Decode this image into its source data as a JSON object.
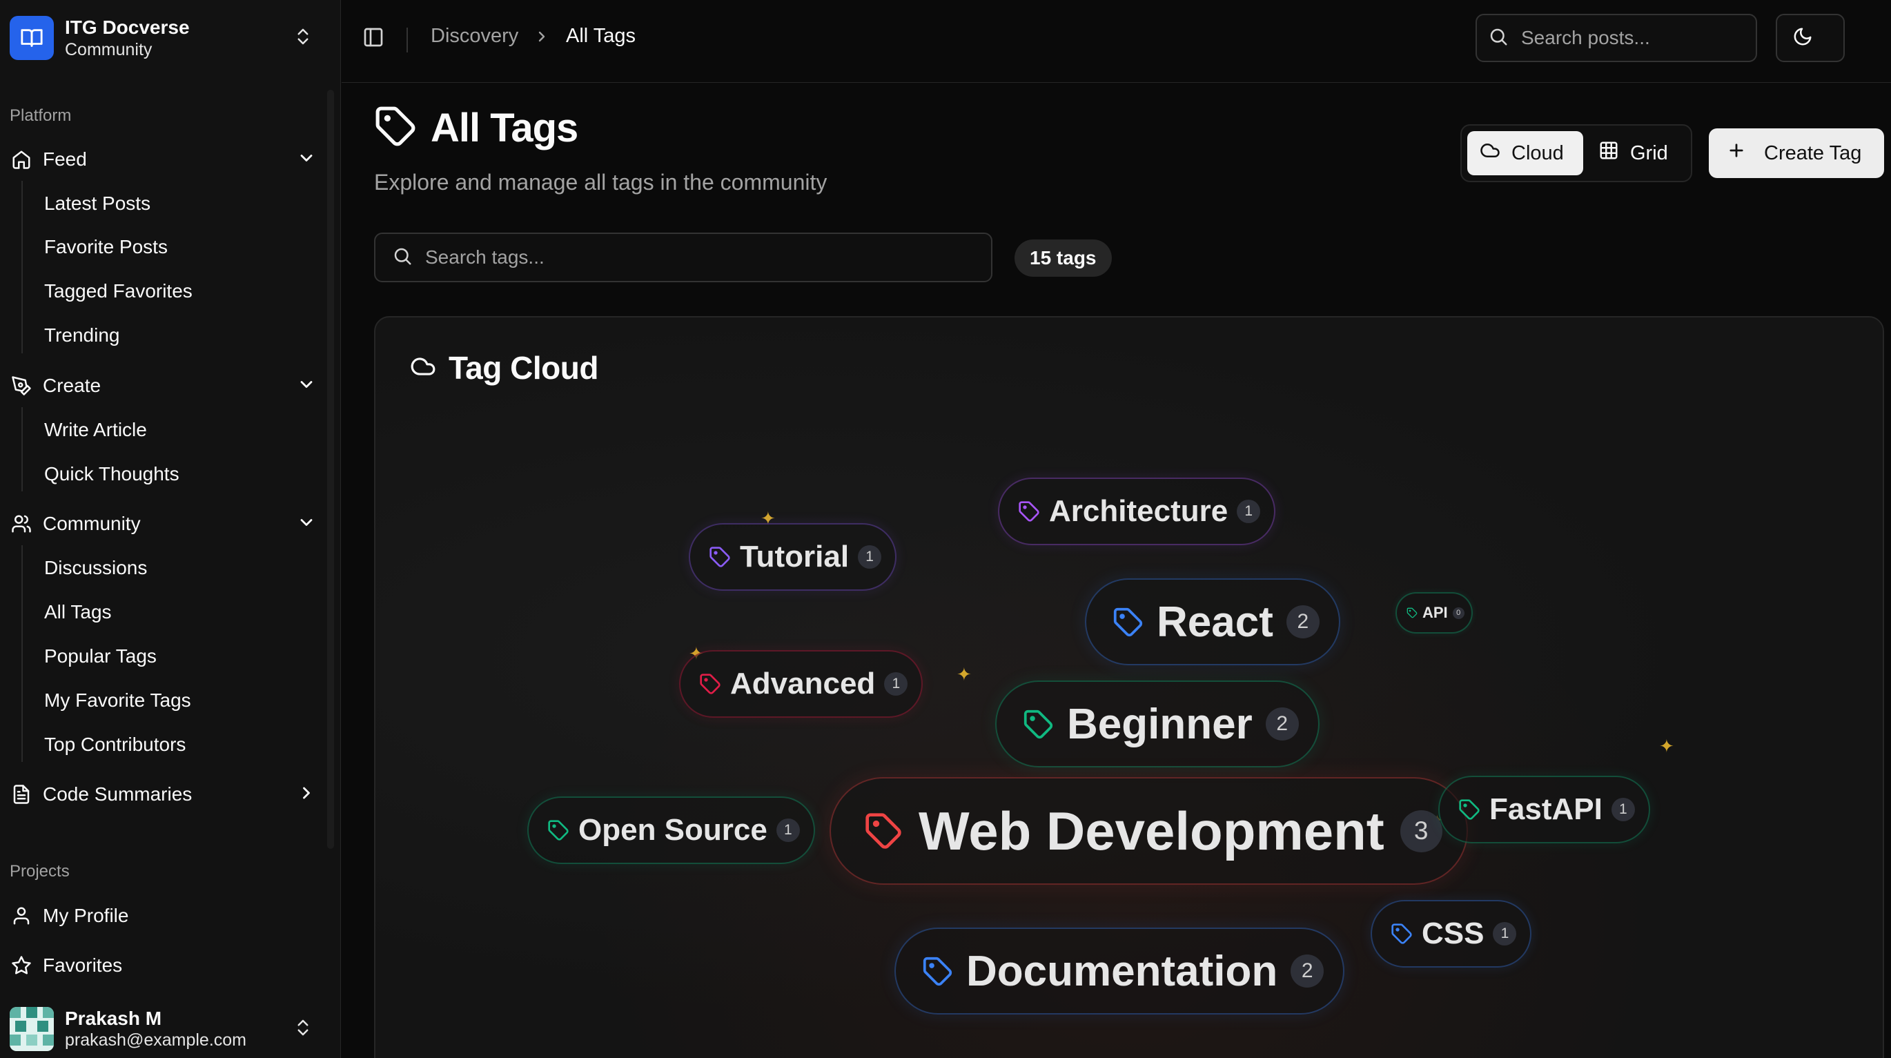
{
  "org": {
    "name": "ITG Docverse",
    "subtitle": "Community"
  },
  "sidebar": {
    "platform_label": "Platform",
    "feed": {
      "label": "Feed",
      "items": [
        "Latest Posts",
        "Favorite Posts",
        "Tagged Favorites",
        "Trending"
      ]
    },
    "create": {
      "label": "Create",
      "items": [
        "Write Article",
        "Quick Thoughts"
      ]
    },
    "community": {
      "label": "Community",
      "items": [
        "Discussions",
        "All Tags",
        "Popular Tags",
        "My Favorite Tags",
        "Top Contributors"
      ]
    },
    "code_summaries": {
      "label": "Code Summaries"
    },
    "projects_label": "Projects",
    "my_profile": "My Profile",
    "favorites": "Favorites"
  },
  "user": {
    "name": "Prakash M",
    "email": "prakash@example.com"
  },
  "header": {
    "breadcrumb": [
      "Discovery",
      "All Tags"
    ],
    "search_placeholder": "Search posts..."
  },
  "page": {
    "title": "All Tags",
    "subtitle": "Explore and manage all tags in the community",
    "view_cloud": "Cloud",
    "view_grid": "Grid",
    "create_tag": "Create Tag",
    "search_tags_placeholder": "Search tags...",
    "tag_count": "15 tags"
  },
  "cloud": {
    "title": "Tag Cloud",
    "tags": [
      {
        "name": "Architecture",
        "count": "1",
        "color": "#a855f7"
      },
      {
        "name": "Tutorial",
        "count": "1",
        "color": "#8b5cf6"
      },
      {
        "name": "React",
        "count": "2",
        "color": "#3b82f6"
      },
      {
        "name": "API",
        "count": "0",
        "color": "#10b981"
      },
      {
        "name": "Advanced",
        "count": "1",
        "color": "#e11d48"
      },
      {
        "name": "Beginner",
        "count": "2",
        "color": "#10b981"
      },
      {
        "name": "Open Source",
        "count": "1",
        "color": "#10b981"
      },
      {
        "name": "Web Development",
        "count": "3",
        "color": "#ef4444"
      },
      {
        "name": "FastAPI",
        "count": "1",
        "color": "#10b981"
      },
      {
        "name": "CSS",
        "count": "1",
        "color": "#3b82f6"
      },
      {
        "name": "Documentation",
        "count": "2",
        "color": "#3b82f6"
      }
    ]
  }
}
